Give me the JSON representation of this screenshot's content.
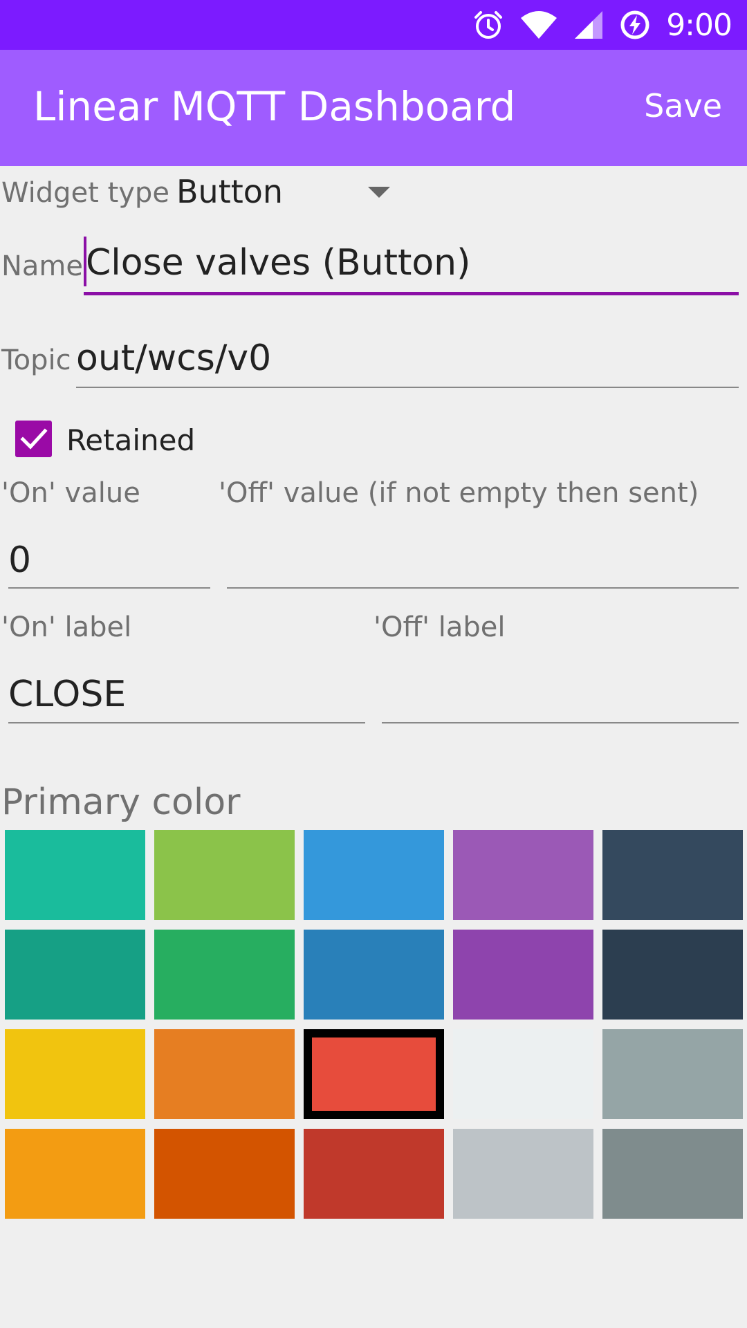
{
  "status_bar": {
    "time": "9:00",
    "icons": [
      "alarm-icon",
      "wifi-icon",
      "signal-icon",
      "battery-charging-icon"
    ]
  },
  "app_bar": {
    "title": "Linear MQTT Dashboard",
    "save_label": "Save"
  },
  "form": {
    "widget_type": {
      "label": "Widget type",
      "value": "Button"
    },
    "name": {
      "label": "Name",
      "value": "Close valves (Button)"
    },
    "topic": {
      "label": "Topic",
      "value": "out/wcs/v0"
    },
    "retained": {
      "label": "Retained",
      "checked": true
    },
    "on_value": {
      "label": "'On' value",
      "value": "0"
    },
    "off_value": {
      "label": "'Off' value (if not empty then sent)",
      "value": ""
    },
    "on_label": {
      "label": "'On' label",
      "value": "CLOSE"
    },
    "off_label": {
      "label": "'Off' label",
      "value": ""
    }
  },
  "primary_color": {
    "heading": "Primary color",
    "selected": "#e74c3c",
    "swatches": [
      [
        "#1abc9c",
        "#8bc34a",
        "#3498db",
        "#9b59b6",
        "#34495e"
      ],
      [
        "#16a085",
        "#27ae60",
        "#2980b9",
        "#8e44ad",
        "#2c3e50"
      ],
      [
        "#f1c40f",
        "#e67e22",
        "#e74c3c",
        "#ecf0f1",
        "#95a5a6"
      ],
      [
        "#f39c12",
        "#d35400",
        "#c0392b",
        "#bdc3c7",
        "#7f8c8d"
      ]
    ]
  },
  "colors": {
    "status_bar": "#7c1bff",
    "app_bar": "#9f5cff",
    "accent": "#8b0fa6",
    "background": "#efefef"
  }
}
